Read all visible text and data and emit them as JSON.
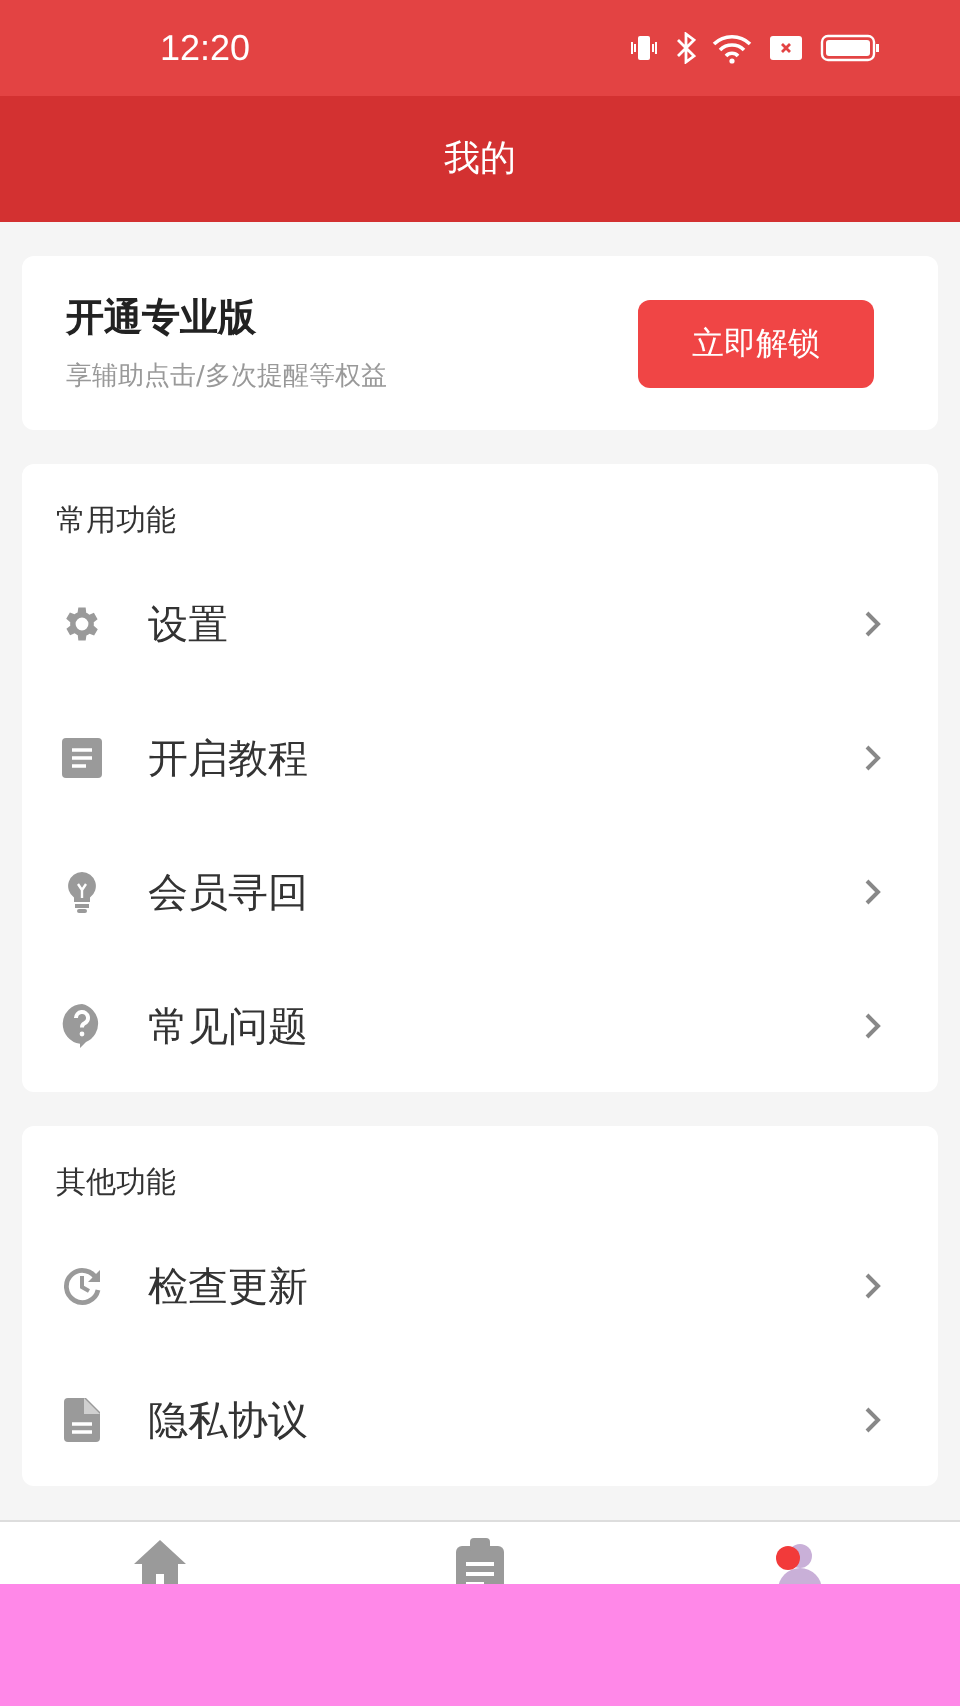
{
  "status_bar": {
    "time": "12:20"
  },
  "header": {
    "title": "我的"
  },
  "promo": {
    "title": "开通专业版",
    "subtitle": "享辅助点击/多次提醒等权益",
    "button": "立即解锁"
  },
  "sections": [
    {
      "title": "常用功能",
      "items": [
        {
          "label": "设置"
        },
        {
          "label": "开启教程"
        },
        {
          "label": "会员寻回"
        },
        {
          "label": "常见问题"
        }
      ]
    },
    {
      "title": "其他功能",
      "items": [
        {
          "label": "检查更新"
        },
        {
          "label": "隐私协议"
        }
      ]
    }
  ],
  "bottom_nav": {
    "items": [
      {
        "badge": false
      },
      {
        "badge": false
      },
      {
        "badge": true
      }
    ]
  }
}
